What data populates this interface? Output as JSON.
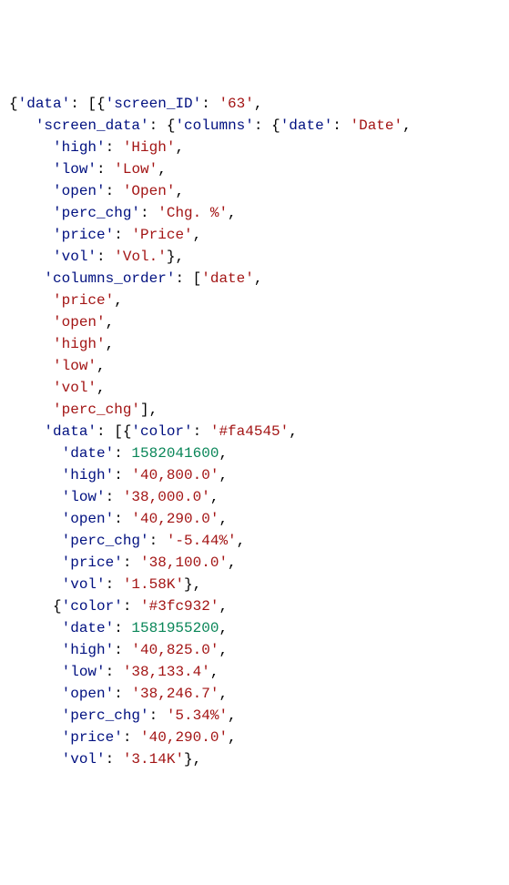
{
  "lines": [
    [
      {
        "t": "pun",
        "v": "{"
      },
      {
        "t": "key",
        "v": "'data'"
      },
      {
        "t": "pun",
        "v": ": [{"
      },
      {
        "t": "key",
        "v": "'screen_ID'"
      },
      {
        "t": "pun",
        "v": ": "
      },
      {
        "t": "str",
        "v": "'63'"
      },
      {
        "t": "pun",
        "v": ","
      }
    ],
    [
      {
        "t": "sp",
        "v": "   "
      },
      {
        "t": "key",
        "v": "'screen_data'"
      },
      {
        "t": "pun",
        "v": ": {"
      },
      {
        "t": "key",
        "v": "'columns'"
      },
      {
        "t": "pun",
        "v": ": {"
      },
      {
        "t": "key",
        "v": "'date'"
      },
      {
        "t": "pun",
        "v": ": "
      },
      {
        "t": "str",
        "v": "'Date'"
      },
      {
        "t": "pun",
        "v": ","
      }
    ],
    [
      {
        "t": "sp",
        "v": "     "
      },
      {
        "t": "key",
        "v": "'high'"
      },
      {
        "t": "pun",
        "v": ": "
      },
      {
        "t": "str",
        "v": "'High'"
      },
      {
        "t": "pun",
        "v": ","
      }
    ],
    [
      {
        "t": "sp",
        "v": "     "
      },
      {
        "t": "key",
        "v": "'low'"
      },
      {
        "t": "pun",
        "v": ": "
      },
      {
        "t": "str",
        "v": "'Low'"
      },
      {
        "t": "pun",
        "v": ","
      }
    ],
    [
      {
        "t": "sp",
        "v": "     "
      },
      {
        "t": "key",
        "v": "'open'"
      },
      {
        "t": "pun",
        "v": ": "
      },
      {
        "t": "str",
        "v": "'Open'"
      },
      {
        "t": "pun",
        "v": ","
      }
    ],
    [
      {
        "t": "sp",
        "v": "     "
      },
      {
        "t": "key",
        "v": "'perc_chg'"
      },
      {
        "t": "pun",
        "v": ": "
      },
      {
        "t": "str",
        "v": "'Chg. %'"
      },
      {
        "t": "pun",
        "v": ","
      }
    ],
    [
      {
        "t": "sp",
        "v": "     "
      },
      {
        "t": "key",
        "v": "'price'"
      },
      {
        "t": "pun",
        "v": ": "
      },
      {
        "t": "str",
        "v": "'Price'"
      },
      {
        "t": "pun",
        "v": ","
      }
    ],
    [
      {
        "t": "sp",
        "v": "     "
      },
      {
        "t": "key",
        "v": "'vol'"
      },
      {
        "t": "pun",
        "v": ": "
      },
      {
        "t": "str",
        "v": "'Vol.'"
      },
      {
        "t": "pun",
        "v": "},"
      }
    ],
    [
      {
        "t": "sp",
        "v": "    "
      },
      {
        "t": "key",
        "v": "'columns_order'"
      },
      {
        "t": "pun",
        "v": ": ["
      },
      {
        "t": "str",
        "v": "'date'"
      },
      {
        "t": "pun",
        "v": ","
      }
    ],
    [
      {
        "t": "sp",
        "v": "     "
      },
      {
        "t": "str",
        "v": "'price'"
      },
      {
        "t": "pun",
        "v": ","
      }
    ],
    [
      {
        "t": "sp",
        "v": "     "
      },
      {
        "t": "str",
        "v": "'open'"
      },
      {
        "t": "pun",
        "v": ","
      }
    ],
    [
      {
        "t": "sp",
        "v": "     "
      },
      {
        "t": "str",
        "v": "'high'"
      },
      {
        "t": "pun",
        "v": ","
      }
    ],
    [
      {
        "t": "sp",
        "v": "     "
      },
      {
        "t": "str",
        "v": "'low'"
      },
      {
        "t": "pun",
        "v": ","
      }
    ],
    [
      {
        "t": "sp",
        "v": "     "
      },
      {
        "t": "str",
        "v": "'vol'"
      },
      {
        "t": "pun",
        "v": ","
      }
    ],
    [
      {
        "t": "sp",
        "v": "     "
      },
      {
        "t": "str",
        "v": "'perc_chg'"
      },
      {
        "t": "pun",
        "v": "],"
      }
    ],
    [
      {
        "t": "sp",
        "v": "    "
      },
      {
        "t": "key",
        "v": "'data'"
      },
      {
        "t": "pun",
        "v": ": [{"
      },
      {
        "t": "key",
        "v": "'color'"
      },
      {
        "t": "pun",
        "v": ": "
      },
      {
        "t": "str",
        "v": "'#fa4545'"
      },
      {
        "t": "pun",
        "v": ","
      }
    ],
    [
      {
        "t": "sp",
        "v": "      "
      },
      {
        "t": "key",
        "v": "'date'"
      },
      {
        "t": "pun",
        "v": ": "
      },
      {
        "t": "num",
        "v": "1582041600"
      },
      {
        "t": "pun",
        "v": ","
      }
    ],
    [
      {
        "t": "sp",
        "v": "      "
      },
      {
        "t": "key",
        "v": "'high'"
      },
      {
        "t": "pun",
        "v": ": "
      },
      {
        "t": "str",
        "v": "'40,800.0'"
      },
      {
        "t": "pun",
        "v": ","
      }
    ],
    [
      {
        "t": "sp",
        "v": "      "
      },
      {
        "t": "key",
        "v": "'low'"
      },
      {
        "t": "pun",
        "v": ": "
      },
      {
        "t": "str",
        "v": "'38,000.0'"
      },
      {
        "t": "pun",
        "v": ","
      }
    ],
    [
      {
        "t": "sp",
        "v": "      "
      },
      {
        "t": "key",
        "v": "'open'"
      },
      {
        "t": "pun",
        "v": ": "
      },
      {
        "t": "str",
        "v": "'40,290.0'"
      },
      {
        "t": "pun",
        "v": ","
      }
    ],
    [
      {
        "t": "sp",
        "v": "      "
      },
      {
        "t": "key",
        "v": "'perc_chg'"
      },
      {
        "t": "pun",
        "v": ": "
      },
      {
        "t": "str",
        "v": "'-5.44%'"
      },
      {
        "t": "pun",
        "v": ","
      }
    ],
    [
      {
        "t": "sp",
        "v": "      "
      },
      {
        "t": "key",
        "v": "'price'"
      },
      {
        "t": "pun",
        "v": ": "
      },
      {
        "t": "str",
        "v": "'38,100.0'"
      },
      {
        "t": "pun",
        "v": ","
      }
    ],
    [
      {
        "t": "sp",
        "v": "      "
      },
      {
        "t": "key",
        "v": "'vol'"
      },
      {
        "t": "pun",
        "v": ": "
      },
      {
        "t": "str",
        "v": "'1.58K'"
      },
      {
        "t": "pun",
        "v": "},"
      }
    ],
    [
      {
        "t": "sp",
        "v": "     {"
      },
      {
        "t": "key",
        "v": "'color'"
      },
      {
        "t": "pun",
        "v": ": "
      },
      {
        "t": "str",
        "v": "'#3fc932'"
      },
      {
        "t": "pun",
        "v": ","
      }
    ],
    [
      {
        "t": "sp",
        "v": "      "
      },
      {
        "t": "key",
        "v": "'date'"
      },
      {
        "t": "pun",
        "v": ": "
      },
      {
        "t": "num",
        "v": "1581955200"
      },
      {
        "t": "pun",
        "v": ","
      }
    ],
    [
      {
        "t": "sp",
        "v": "      "
      },
      {
        "t": "key",
        "v": "'high'"
      },
      {
        "t": "pun",
        "v": ": "
      },
      {
        "t": "str",
        "v": "'40,825.0'"
      },
      {
        "t": "pun",
        "v": ","
      }
    ],
    [
      {
        "t": "sp",
        "v": "      "
      },
      {
        "t": "key",
        "v": "'low'"
      },
      {
        "t": "pun",
        "v": ": "
      },
      {
        "t": "str",
        "v": "'38,133.4'"
      },
      {
        "t": "pun",
        "v": ","
      }
    ],
    [
      {
        "t": "sp",
        "v": "      "
      },
      {
        "t": "key",
        "v": "'open'"
      },
      {
        "t": "pun",
        "v": ": "
      },
      {
        "t": "str",
        "v": "'38,246.7'"
      },
      {
        "t": "pun",
        "v": ","
      }
    ],
    [
      {
        "t": "sp",
        "v": "      "
      },
      {
        "t": "key",
        "v": "'perc_chg'"
      },
      {
        "t": "pun",
        "v": ": "
      },
      {
        "t": "str",
        "v": "'5.34%'"
      },
      {
        "t": "pun",
        "v": ","
      }
    ],
    [
      {
        "t": "sp",
        "v": "      "
      },
      {
        "t": "key",
        "v": "'price'"
      },
      {
        "t": "pun",
        "v": ": "
      },
      {
        "t": "str",
        "v": "'40,290.0'"
      },
      {
        "t": "pun",
        "v": ","
      }
    ],
    [
      {
        "t": "sp",
        "v": "      "
      },
      {
        "t": "key",
        "v": "'vol'"
      },
      {
        "t": "pun",
        "v": ": "
      },
      {
        "t": "str",
        "v": "'3.14K'"
      },
      {
        "t": "pun",
        "v": "},"
      }
    ]
  ]
}
